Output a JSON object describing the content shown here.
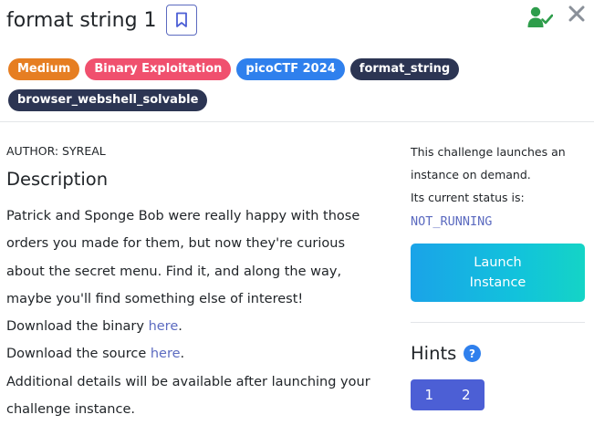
{
  "challenge": {
    "title": "format string 1",
    "bookmark_icon": "bookmark-icon",
    "solved_icon": "user-check-icon",
    "close_icon": "close-icon"
  },
  "tags": [
    {
      "label": "Medium",
      "color": "#e67e22"
    },
    {
      "label": "Binary Exploitation",
      "color": "#f0506e"
    },
    {
      "label": "picoCTF 2024",
      "color": "#2f80ed"
    },
    {
      "label": "format_string",
      "color": "#2c3553"
    },
    {
      "label": "browser_webshell_solvable",
      "color": "#2c3553"
    }
  ],
  "details": {
    "author": "AUTHOR: SYREAL",
    "heading": "Description",
    "lines": [
      "Patrick and Sponge Bob were really happy with those",
      "orders you made for them, but now they're curious",
      "about the secret menu. Find it, and along the way,",
      "maybe you'll find something else of interest!"
    ],
    "binary_prefix": "Download the binary ",
    "binary_link": "here",
    "source_prefix": "Download the source ",
    "source_link": "here",
    "period": ".",
    "additional_1": "Additional details will be available after launching your",
    "additional_2": "challenge instance."
  },
  "instance": {
    "line_1": "This challenge launches an",
    "line_2": "instance on demand.",
    "line_3": "Its current status is:",
    "status": "NOT_RUNNING",
    "launch_line_1": "Launch",
    "launch_line_2": "Instance"
  },
  "hints": {
    "title": "Hints",
    "help_icon": "question-circle-icon",
    "items": [
      "1",
      "2"
    ]
  },
  "colors": {
    "accent": "#5c6bc0",
    "hint_button": "#4c5fd5",
    "solved_green": "#2e9d4b"
  }
}
